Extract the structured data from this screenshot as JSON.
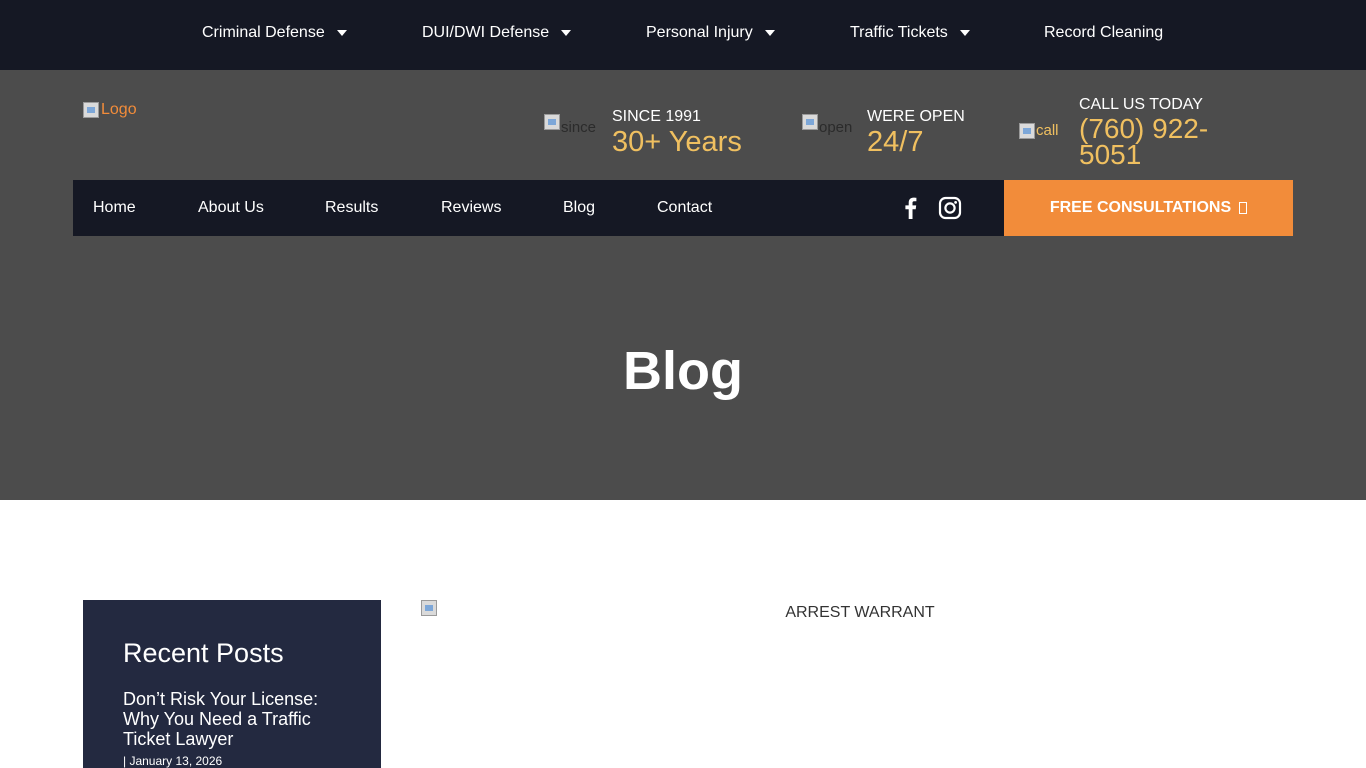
{
  "topbar": {
    "items": [
      {
        "label": "Criminal Defense",
        "dropdown": true
      },
      {
        "label": "DUI/DWI Defense",
        "dropdown": true
      },
      {
        "label": "Personal Injury",
        "dropdown": true
      },
      {
        "label": "Traffic Tickets",
        "dropdown": true
      },
      {
        "label": "Record Cleaning",
        "dropdown": false
      }
    ]
  },
  "header": {
    "logo_alt": "Logo",
    "since": {
      "icon_alt": "since",
      "label": "SINCE 1991",
      "value": "30+ Years"
    },
    "open": {
      "icon_alt": "open",
      "label": "WERE OPEN",
      "value": "24/7"
    },
    "call": {
      "icon_alt": "call",
      "label": "CALL US TODAY",
      "value": "(760) 922-5051"
    }
  },
  "nav": {
    "links": [
      "Home",
      "About Us",
      "Results",
      "Reviews",
      "Blog",
      "Contact"
    ],
    "social": [
      "facebook-icon",
      "instagram-icon"
    ],
    "cta_label": "FREE CONSULTATIONS"
  },
  "page": {
    "title": "Blog"
  },
  "sidebar": {
    "heading": "Recent Posts",
    "posts": [
      {
        "title": "Don’t Risk Your License: Why You Need a Traffic Ticket Lawyer",
        "date": "| January 13, 2026"
      }
    ]
  },
  "article": {
    "image_alt": "ARREST WARRANT"
  },
  "colors": {
    "dark": "#151824",
    "header_gray": "#4c4c4c",
    "accent_orange": "#f28c3a",
    "accent_gold": "#f0c060",
    "sidebar_navy": "#232940"
  }
}
